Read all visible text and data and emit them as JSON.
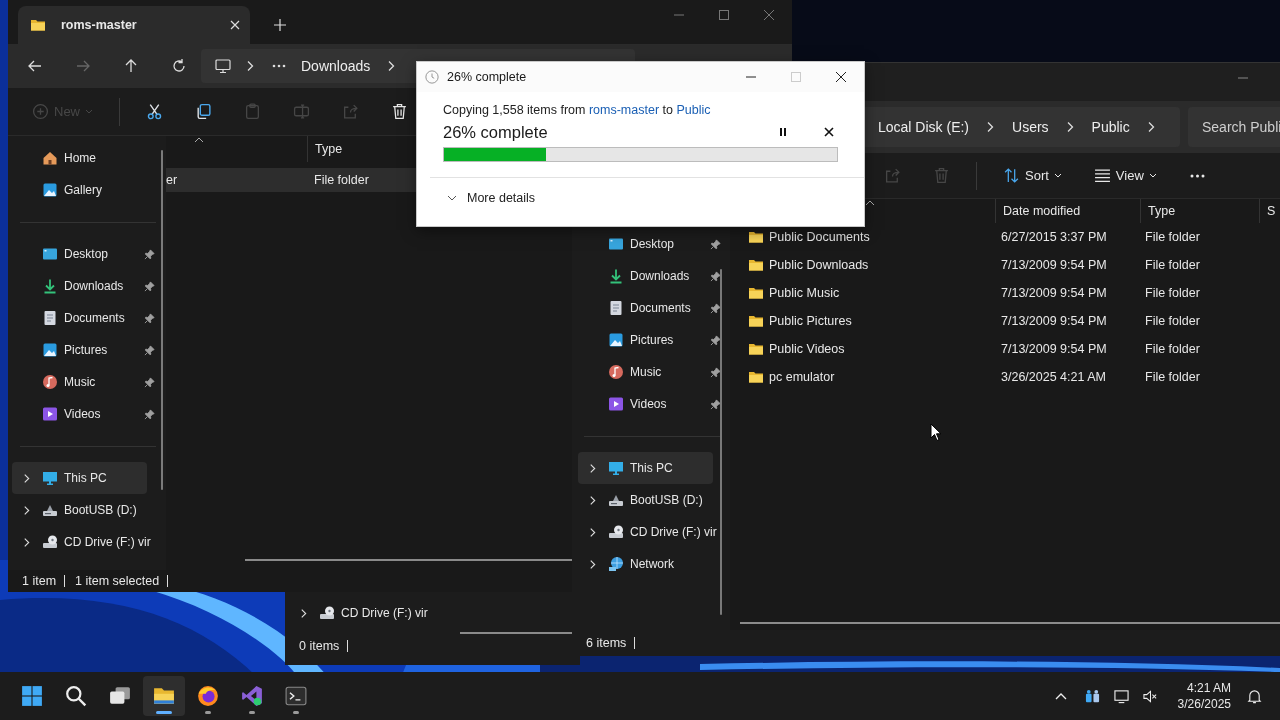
{
  "explorer_roms": {
    "tab": {
      "title": "roms-master",
      "selected": true
    },
    "address": [
      "Downloads"
    ],
    "toolbar": [
      {
        "kind": "new",
        "label": "New",
        "disabled": true
      },
      {
        "kind": "cut",
        "disabled": false
      },
      {
        "kind": "copy",
        "disabled": false
      },
      {
        "kind": "paste",
        "disabled": true
      },
      {
        "kind": "rename",
        "disabled": true
      },
      {
        "kind": "share",
        "disabled": true
      },
      {
        "kind": "delete",
        "disabled": false
      }
    ],
    "sidebar": [
      [
        {
          "kind": "home",
          "label": "Home",
          "pinned": false,
          "expandable": false,
          "selected": false
        },
        {
          "kind": "gallery",
          "label": "Gallery",
          "pinned": false,
          "expandable": false,
          "selected": false
        }
      ],
      [
        {
          "kind": "desktop",
          "label": "Desktop",
          "pinned": true,
          "expandable": false,
          "selected": false
        },
        {
          "kind": "downloads",
          "label": "Downloads",
          "pinned": true,
          "expandable": false,
          "selected": false
        },
        {
          "kind": "documents",
          "label": "Documents",
          "pinned": true,
          "expandable": false,
          "selected": false
        },
        {
          "kind": "pictures",
          "label": "Pictures",
          "pinned": true,
          "expandable": false,
          "selected": false
        },
        {
          "kind": "music",
          "label": "Music",
          "pinned": true,
          "expandable": false,
          "selected": false
        },
        {
          "kind": "videos",
          "label": "Videos",
          "pinned": true,
          "expandable": false,
          "selected": false
        }
      ],
      [
        {
          "kind": "pc",
          "label": "This PC",
          "pinned": false,
          "expandable": true,
          "selected": true
        },
        {
          "kind": "usb",
          "label": "BootUSB (D:)",
          "pinned": false,
          "expandable": true,
          "selected": false
        },
        {
          "kind": "cd",
          "label": "CD Drive (F:) vir",
          "pinned": false,
          "expandable": true,
          "selected": false
        }
      ]
    ],
    "columns": [
      "Type"
    ],
    "rows": [
      {
        "column_1": "er",
        "type": "File folder",
        "selected": true
      }
    ],
    "status": [
      "1 item",
      "1 item selected"
    ]
  },
  "explorer_back": {
    "sidebar": [
      {
        "kind": "cd",
        "label": "CD Drive (F:) vir",
        "expandable": true
      }
    ],
    "status": [
      "0 items"
    ]
  },
  "explorer_public": {
    "address": [
      "Local Disk (E:)",
      "Users",
      "Public"
    ],
    "search": {
      "placeholder": "Search Publi"
    },
    "toolbar": [
      {
        "kind": "share",
        "disabled": true
      },
      {
        "kind": "delete",
        "disabled": true
      },
      {
        "kind": "sort",
        "label": "Sort",
        "disabled": false
      },
      {
        "kind": "view",
        "label": "View",
        "disabled": false
      },
      {
        "kind": "more",
        "disabled": false
      }
    ],
    "sidebar": [
      [
        {
          "kind": "desktop",
          "label": "Desktop",
          "pinned": true,
          "expandable": false,
          "selected": false
        },
        {
          "kind": "downloads",
          "label": "Downloads",
          "pinned": true,
          "expandable": false,
          "selected": false
        },
        {
          "kind": "documents",
          "label": "Documents",
          "pinned": true,
          "expandable": false,
          "selected": false
        },
        {
          "kind": "pictures",
          "label": "Pictures",
          "pinned": true,
          "expandable": false,
          "selected": false
        },
        {
          "kind": "music",
          "label": "Music",
          "pinned": true,
          "expandable": false,
          "selected": false
        },
        {
          "kind": "videos",
          "label": "Videos",
          "pinned": true,
          "expandable": false,
          "selected": false
        }
      ],
      [
        {
          "kind": "pc",
          "label": "This PC",
          "pinned": false,
          "expandable": true,
          "selected": true
        },
        {
          "kind": "usb",
          "label": "BootUSB (D:)",
          "pinned": false,
          "expandable": true,
          "selected": false
        },
        {
          "kind": "cd",
          "label": "CD Drive (F:) vir",
          "pinned": false,
          "expandable": true,
          "selected": false
        },
        {
          "kind": "network",
          "label": "Network",
          "pinned": false,
          "expandable": true,
          "selected": false
        }
      ]
    ],
    "columns": [
      "Date modified",
      "Type",
      "S"
    ],
    "rows": [
      {
        "name": "Public Documents",
        "date_modified": "6/27/2015 3:37 PM",
        "type": "File folder",
        "selected": false
      },
      {
        "name": "Public Downloads",
        "date_modified": "7/13/2009 9:54 PM",
        "type": "File folder",
        "selected": false
      },
      {
        "name": "Public Music",
        "date_modified": "7/13/2009 9:54 PM",
        "type": "File folder",
        "selected": false
      },
      {
        "name": "Public Pictures",
        "date_modified": "7/13/2009 9:54 PM",
        "type": "File folder",
        "selected": false
      },
      {
        "name": "Public Videos",
        "date_modified": "7/13/2009 9:54 PM",
        "type": "File folder",
        "selected": false
      },
      {
        "name": "pc emulator",
        "date_modified": "3/26/2025 4:21 AM",
        "type": "File folder",
        "selected": false
      }
    ],
    "status": [
      "6 items"
    ]
  },
  "copy_dialog": {
    "title": "26% complete",
    "message": {
      "text_before": "Copying 1,558 items from",
      "source": "roms-master",
      "text_between": "to",
      "destination": "Public"
    },
    "heading": "26% complete",
    "progress": {
      "level": 0.26
    },
    "details": "More details"
  },
  "taskbar": {
    "apps": [
      {
        "kind": "start",
        "running": false,
        "selected": false
      },
      {
        "kind": "search",
        "running": false,
        "selected": false
      },
      {
        "kind": "taskview",
        "running": false,
        "selected": false
      },
      {
        "kind": "explorer",
        "running": true,
        "selected": true
      },
      {
        "kind": "browser",
        "running": true,
        "selected": false
      },
      {
        "kind": "studio",
        "running": true,
        "selected": false
      },
      {
        "kind": "terminal",
        "running": true,
        "selected": false
      }
    ],
    "time": "4:21 AM",
    "date": "3/26/2025"
  }
}
